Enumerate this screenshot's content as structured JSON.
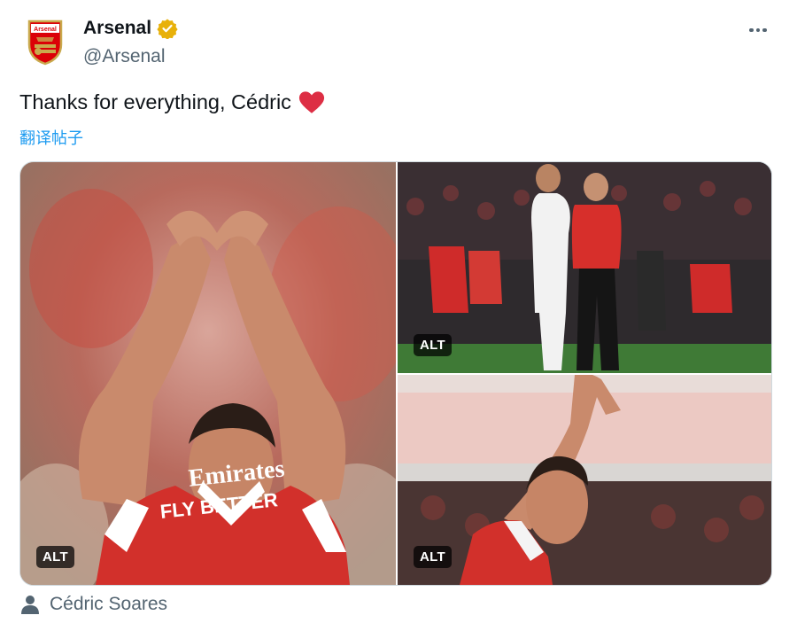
{
  "account": {
    "display_name": "Arsenal",
    "handle": "@Arsenal",
    "crest_text": "Arsenal",
    "verified_color": "#e8b10a"
  },
  "tweet": {
    "text": "Thanks for everything, Cédric",
    "emoji": "heart-icon",
    "translate_label": "翻译帖子"
  },
  "media": {
    "photos": [
      {
        "alt_label": "ALT",
        "shirt_sponsor_line1": "Emirates",
        "shirt_sponsor_line2": "FLY BETTER"
      },
      {
        "alt_label": "ALT"
      },
      {
        "alt_label": "ALT"
      }
    ]
  },
  "tagged": {
    "label": "Cédric Soares"
  },
  "colors": {
    "link": "#1d9bf0",
    "secondary_text": "#536471",
    "heart": "#e0245e"
  }
}
